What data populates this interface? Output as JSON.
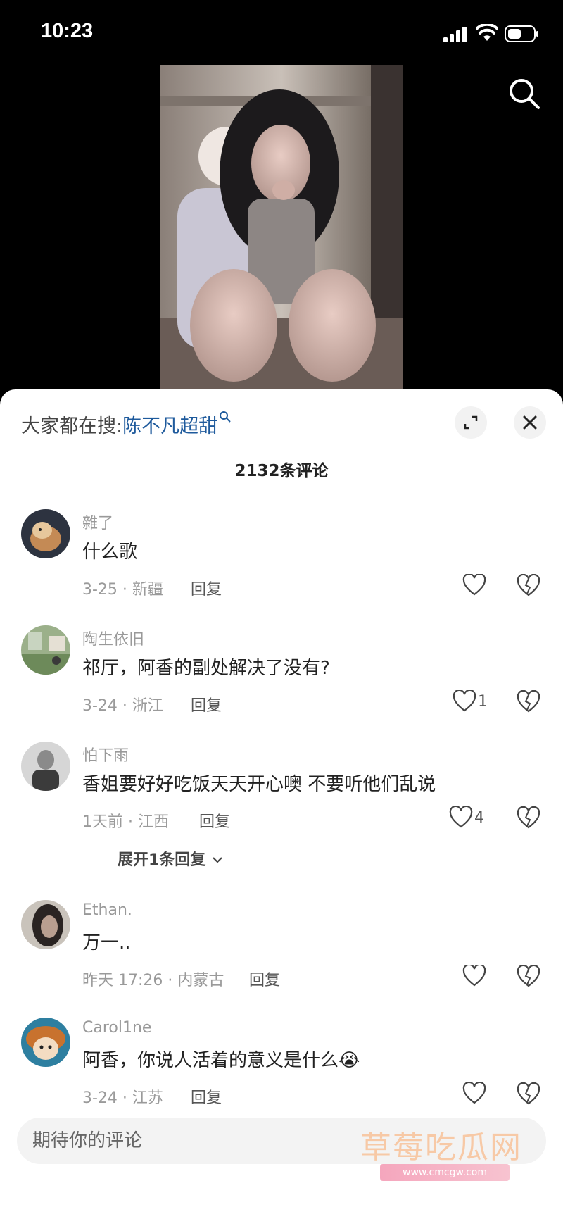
{
  "status_bar": {
    "time": "10:23"
  },
  "trending": {
    "prefix": "大家都在搜:",
    "keyword": "陈不凡超甜"
  },
  "comments_title": "2132条评论",
  "comments": [
    {
      "user": "雜了",
      "text": "什么歌",
      "meta": "3-25 · 新疆",
      "reply": "回复",
      "likes": ""
    },
    {
      "user": "陶生依旧",
      "text": "祁厅，阿香的副处解决了没有?",
      "meta": "3-24 · 浙江",
      "reply": "回复",
      "likes": "1"
    },
    {
      "user": "怕下雨",
      "text": "香姐要好好吃饭天天开心噢 不要听他们乱说",
      "meta": "1天前 · 江西",
      "reply": "回复",
      "likes": "4",
      "expand": "展开1条回复"
    },
    {
      "user": "Ethan.",
      "text": "万一..",
      "meta": "昨天 17:26 · 内蒙古",
      "reply": "回复",
      "likes": ""
    },
    {
      "user": "Carol1ne",
      "text": "阿香，你说人活着的意义是什么😭",
      "meta": "3-24 · 江苏",
      "reply": "回复",
      "likes": ""
    }
  ],
  "input": {
    "placeholder": "期待你的评论"
  },
  "watermark": {
    "text": "草莓吃瓜网",
    "url": "www.cmcgw.com"
  },
  "icons": {
    "search": "search-icon",
    "expand": "expand-icon",
    "close": "close-icon",
    "like": "heart-icon",
    "dislike": "broken-heart-icon"
  },
  "colors": {
    "keyword": "#1e5a9c",
    "panel": "#ffffff",
    "background": "#000000"
  }
}
